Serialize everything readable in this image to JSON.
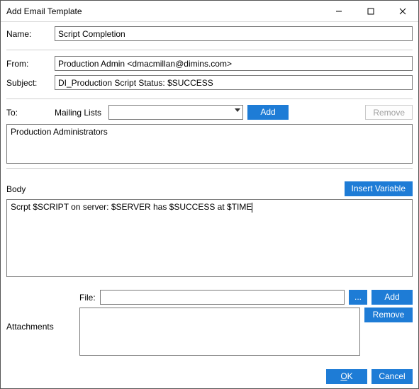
{
  "window": {
    "title": "Add Email Template"
  },
  "labels": {
    "name": "Name:",
    "from": "From:",
    "subject": "Subject:",
    "to": "To:",
    "mailing_lists": "Mailing Lists",
    "body": "Body",
    "file": "File:",
    "attachments": "Attachments"
  },
  "fields": {
    "name": "Script Completion",
    "from": "Production Admin <dmacmillan@dimins.com>",
    "subject": "DI_Production Script Status: $SUCCESS",
    "mailing_list_selected": "",
    "to_list": [
      "Production Administrators"
    ],
    "body_text": "Scrpt $SCRIPT on server: $SERVER has $SUCCESS at $TIME",
    "file": ""
  },
  "attachments": [],
  "buttons": {
    "add_mailing": "Add",
    "remove_mailing": "Remove",
    "insert_variable": "Insert Variable",
    "browse": "...",
    "add_file": "Add",
    "remove_file": "Remove",
    "ok_prefix": "O",
    "ok_rest": "K",
    "cancel": "Cancel"
  }
}
